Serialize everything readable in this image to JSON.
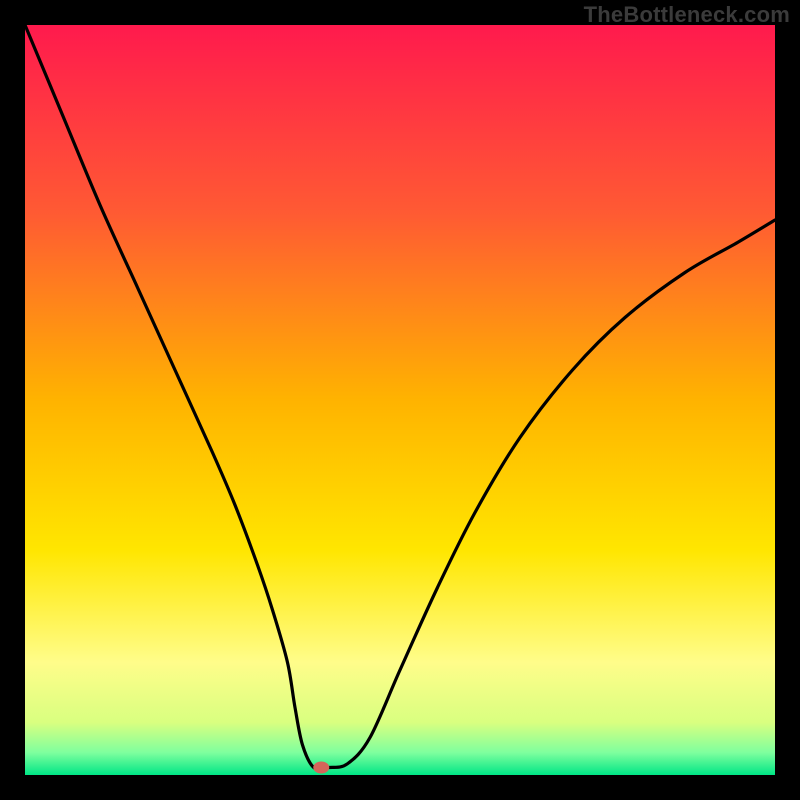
{
  "watermark": "TheBottleneck.com",
  "chart_data": {
    "type": "line",
    "title": "",
    "xlabel": "",
    "ylabel": "",
    "xlim": [
      0,
      100
    ],
    "ylim": [
      0,
      100
    ],
    "grid": false,
    "legend": false,
    "background_gradient": {
      "stops": [
        {
          "offset": 0.0,
          "color": "#ff1a4d"
        },
        {
          "offset": 0.25,
          "color": "#ff5a33"
        },
        {
          "offset": 0.5,
          "color": "#ffb300"
        },
        {
          "offset": 0.7,
          "color": "#ffe600"
        },
        {
          "offset": 0.85,
          "color": "#fffd8a"
        },
        {
          "offset": 0.93,
          "color": "#d9ff80"
        },
        {
          "offset": 0.97,
          "color": "#7fff9e"
        },
        {
          "offset": 1.0,
          "color": "#00e686"
        }
      ]
    },
    "series": [
      {
        "name": "bottleneck-curve",
        "color": "#000000",
        "x": [
          0,
          5,
          10,
          15,
          20,
          25,
          28,
          31,
          33,
          35,
          36,
          37,
          38.5,
          40.5,
          43,
          46,
          50,
          55,
          60,
          66,
          73,
          80,
          88,
          95,
          100
        ],
        "y": [
          100,
          88,
          76,
          65,
          54,
          43,
          36,
          28,
          22,
          15,
          9,
          4,
          1,
          1,
          1.5,
          5,
          14,
          25,
          35,
          45,
          54,
          61,
          67,
          71,
          74
        ]
      }
    ],
    "marker": {
      "name": "optimal-point",
      "x": 39.5,
      "y": 1,
      "color": "#d4655a",
      "rx": 8,
      "ry": 6
    }
  }
}
